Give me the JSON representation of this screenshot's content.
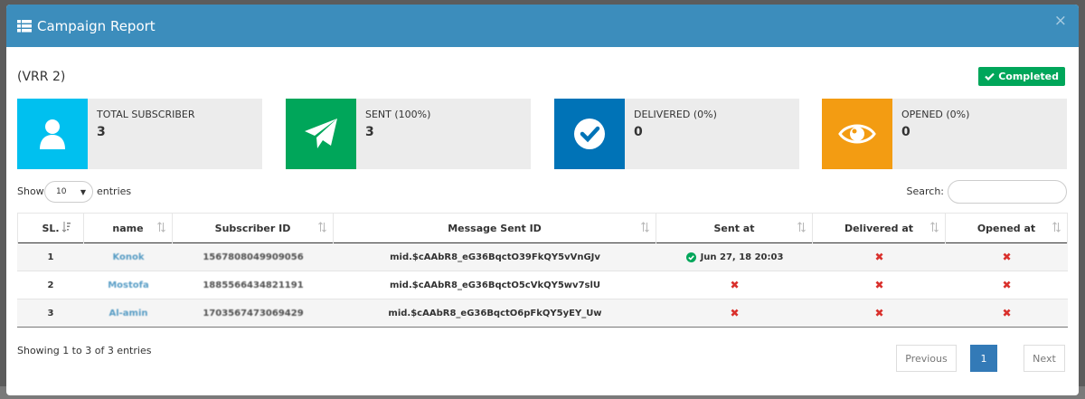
{
  "modal": {
    "title": "Campaign Report",
    "close_label": "×",
    "report_name": "(VRR 2)",
    "status_badge": "Completed",
    "colors": {
      "header": "#3c8dbc",
      "total_subscriber": "#00c0ef",
      "sent": "#00a65a",
      "delivered": "#0073b7",
      "opened": "#f39c12",
      "badge": "#00a65a"
    }
  },
  "stats": [
    {
      "label": "TOTAL SUBSCRIBER",
      "value": "3",
      "icon": "user-icon"
    },
    {
      "label": "SENT (100%)",
      "value": "3",
      "icon": "paper-plane-icon"
    },
    {
      "label": "DELIVERED (0%)",
      "value": "0",
      "icon": "check-circle-icon"
    },
    {
      "label": "OPENED (0%)",
      "value": "0",
      "icon": "eye-icon"
    }
  ],
  "controls": {
    "show_label": "Show",
    "length_value": "10",
    "entries_label": "entries",
    "search_label": "Search:"
  },
  "table": {
    "headers": [
      "SL.",
      "name",
      "Subscriber ID",
      "Message Sent ID",
      "Sent at",
      "Delivered at",
      "Opened at"
    ],
    "rows": [
      {
        "sl": "1",
        "name": "Konok",
        "subscriber_id": "1567808049909056",
        "message_id": "mid.$cAAbR8_eG36BqctO39FkQY5vVnGJv",
        "sent_at": "Jun 27, 18 20:03",
        "delivered_at": "✖",
        "opened_at": "✖"
      },
      {
        "sl": "2",
        "name": "Mostofa",
        "subscriber_id": "1885566434821191",
        "message_id": "mid.$cAAbR8_eG36BqctO5cVkQY5wv7slU",
        "sent_at": "✖",
        "delivered_at": "✖",
        "opened_at": "✖"
      },
      {
        "sl": "3",
        "name": "Al-amin",
        "subscriber_id": "1703567473069429",
        "message_id": "mid.$cAAbR8_eG36BqctO6pFkQY5yEY_Uw",
        "sent_at": "✖",
        "delivered_at": "✖",
        "opened_at": "✖"
      }
    ]
  },
  "footer": {
    "info": "Showing 1 to 3 of 3 entries",
    "previous": "Previous",
    "page": "1",
    "next": "Next"
  }
}
